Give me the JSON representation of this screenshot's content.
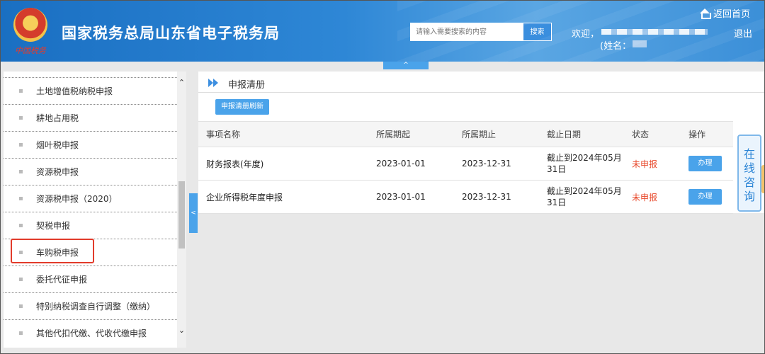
{
  "header": {
    "emblem_text": "中国税务",
    "site_title": "国家税务总局山东省电子税务局",
    "search_placeholder": "请输入需要搜索的内容",
    "search_button": "搜索",
    "welcome": "欢迎，",
    "name_label": "(姓名：",
    "home_link": "返回首页",
    "logout": "退出"
  },
  "collapse_top_label": "^",
  "collapse_left_label": "<",
  "sidebar": {
    "items": [
      {
        "label": "土地增值税纳税申报"
      },
      {
        "label": "耕地占用税"
      },
      {
        "label": "烟叶税申报"
      },
      {
        "label": "资源税申报"
      },
      {
        "label": "资源税申报（2020）"
      },
      {
        "label": "契税申报"
      },
      {
        "label": "车购税申报"
      },
      {
        "label": "委托代征申报"
      },
      {
        "label": "特别纳税调查自行调整（缴纳）"
      },
      {
        "label": "其他代扣代缴、代收代缴申报"
      }
    ],
    "highlighted_item": "车购税申报",
    "scroll_up": "⌃",
    "scroll_down": "⌄"
  },
  "panel": {
    "title": "申报清册",
    "refresh_button": "申报清册刷新",
    "columns": [
      "事项名称",
      "所属期起",
      "所属期止",
      "截止日期",
      "状态",
      "操作"
    ],
    "rows": [
      {
        "name": "财务报表(年度)",
        "start": "2023-01-01",
        "end": "2023-12-31",
        "deadline": "截止到2024年05月31日",
        "status": "未申报",
        "action": "办理"
      },
      {
        "name": "企业所得税年度申报",
        "start": "2023-01-01",
        "end": "2023-12-31",
        "deadline": "截止到2024年05月31日",
        "status": "未申报",
        "action": "办理"
      }
    ]
  },
  "consult": {
    "chars": [
      "在",
      "线",
      "咨",
      "询"
    ]
  },
  "colors": {
    "accent": "#4aa3ea",
    "status_red": "#e8492c",
    "highlight_border": "#e23b2b"
  }
}
